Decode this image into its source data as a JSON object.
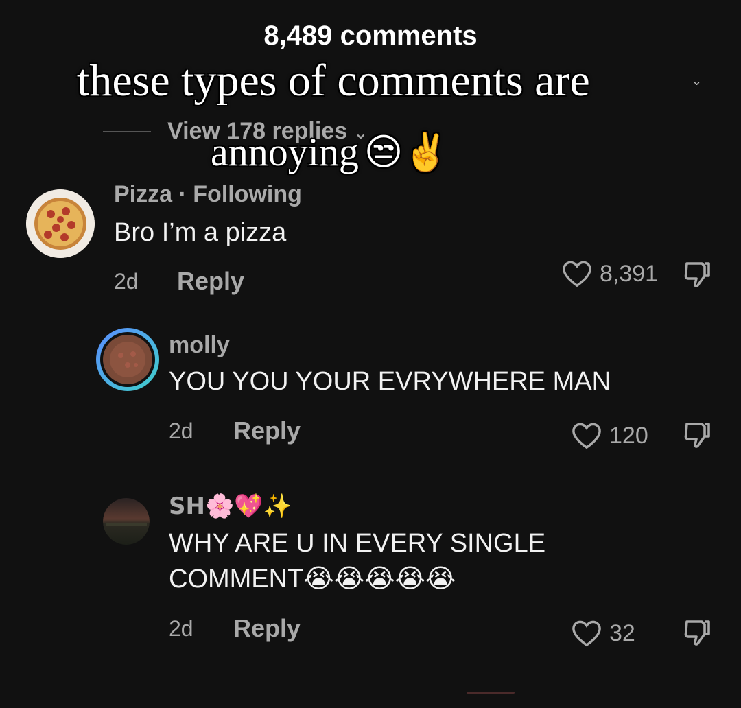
{
  "header": {
    "comments_count": "8,489 comments"
  },
  "overlay": {
    "caption_line1": "these types of comments are",
    "caption_line2": "annoying",
    "caption_emoji": "😒✌️"
  },
  "view_replies": "View 178 replies",
  "comments": [
    {
      "author": "Pizza · Following",
      "text": "Bro I’m a pizza",
      "age": "2d",
      "reply_label": "Reply",
      "likes": "8,391"
    },
    {
      "author": "molly",
      "text": "YOU YOU YOUR EVRYWHERE MAN",
      "age": "2d",
      "reply_label": "Reply",
      "likes": "120"
    },
    {
      "author": "SH🌸💖✨",
      "text_line1": "WHY ARE U IN EVERY SINGLE",
      "text_line2": "COMMENT😭😭😭😭😭",
      "age": "2d",
      "reply_label": "Reply",
      "likes": "32"
    }
  ],
  "colors": {
    "background": "#111111",
    "muted_text": "#a9a9a9",
    "primary_text": "#f2f2f2",
    "story_ring_start": "#5b8cff",
    "story_ring_end": "#3fd0c9"
  },
  "icons": [
    "heart-icon",
    "dislike-icon",
    "chevron-down-icon"
  ]
}
